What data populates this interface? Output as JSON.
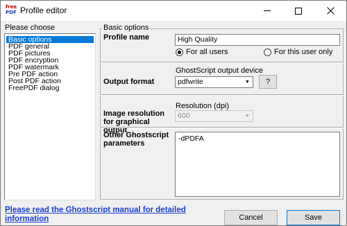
{
  "window": {
    "title": "Profile editor",
    "app_icon_line1": "free",
    "app_icon_line2": "PDF"
  },
  "sidebar": {
    "label": "Please choose",
    "items": [
      {
        "label": "Basic options",
        "selected": true
      },
      {
        "label": "PDF general",
        "selected": false
      },
      {
        "label": "PDF pictures",
        "selected": false
      },
      {
        "label": "PDF encryption",
        "selected": false
      },
      {
        "label": "PDF watermark",
        "selected": false
      },
      {
        "label": "Pre PDF action",
        "selected": false
      },
      {
        "label": "Post PDF action",
        "selected": false
      },
      {
        "label": "FreePDF dialog",
        "selected": false
      }
    ]
  },
  "main": {
    "group_title": "Basic options",
    "profile_name": {
      "label": "Profile name",
      "value": "High Quality",
      "radio_all_users": "For all users",
      "radio_this_user": "For this user only",
      "selected": "all_users"
    },
    "output_format": {
      "label": "Output format",
      "device_label": "GhostScript output device",
      "device_value": "pdfwrite",
      "help_button": "?"
    },
    "resolution": {
      "label": "Image resolution for graphical output",
      "sub_label": "Resolution (dpi)",
      "value": "600",
      "enabled": false
    },
    "other_params": {
      "label": "Other Ghostscript parameters",
      "value": "-dPDFA"
    }
  },
  "footer": {
    "help_link": "Please read the Ghostscript manual for detailed information",
    "cancel_label": "Cancel",
    "save_label": "Save"
  },
  "colors": {
    "selection": "#0078d7",
    "link": "#1a3fd0",
    "dialog_bg": "#f0f0f0"
  }
}
